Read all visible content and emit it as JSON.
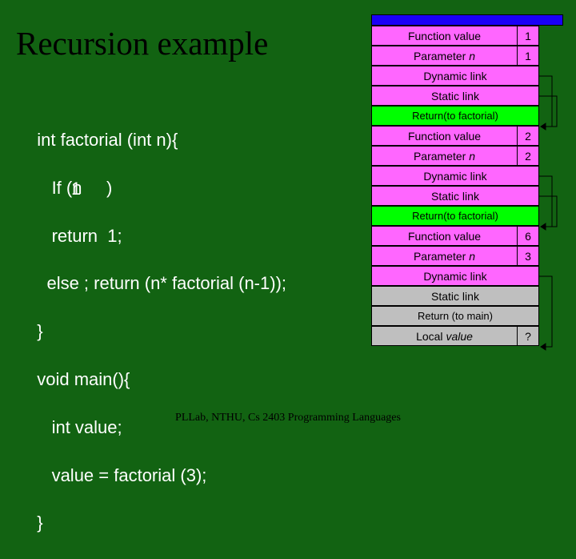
{
  "title": "Recursion example",
  "code": "int factorial (int n){\n   If (n     )\n   return  1;\n  else ; return (n* factorial (n-1));\n                1\n}\nvoid main(){\n   int value;\n   value = factorial (3);\n}",
  "codeLines": [
    "int factorial (int n){",
    "   If (n     )",
    "   return  1;",
    "  else ; return (n* factorial (n-1));",
    "}",
    "void main(){",
    "   int value;",
    "   value = factorial (3);",
    "}"
  ],
  "codeOverlay": "1",
  "footer": "PLLab, NTHU, Cs 2403 Programming Languages",
  "stack": {
    "frames": [
      {
        "fv_label": "Function value",
        "fv_val": "1",
        "pn_label": "Parameter",
        "pn_name": "n",
        "pn_val": "1",
        "dyn": "Dynamic link",
        "stat": "Static link",
        "ret": "Return(to factorial)"
      },
      {
        "fv_label": "Function value",
        "fv_val": "2",
        "pn_label": "Parameter",
        "pn_name": "n",
        "pn_val": "2",
        "dyn": "Dynamic link",
        "stat": "Static link",
        "ret": "Return(to factorial)"
      },
      {
        "fv_label": "Function value",
        "fv_val": "6",
        "pn_label": "Parameter",
        "pn_name": "n",
        "pn_val": "3",
        "dyn": "Dynamic link",
        "stat": "Static link",
        "ret": "Return (to main)"
      }
    ],
    "mainFrame": {
      "lv_label": "Local",
      "lv_name": "value",
      "lv_val": "?"
    }
  }
}
